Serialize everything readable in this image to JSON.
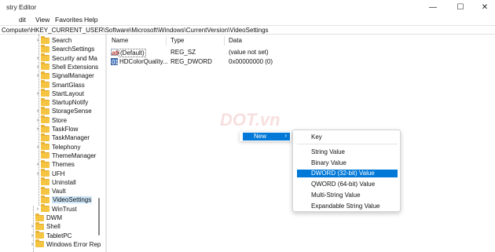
{
  "window": {
    "title": "stry Editor",
    "controls": {
      "minimize": "—",
      "maximize": "☐",
      "close": "✕"
    }
  },
  "menubar": {
    "items": [
      "dit",
      "View",
      "Favorites",
      "Help"
    ]
  },
  "address": "Computer\\HKEY_CURRENT_USER\\Software\\Microsoft\\Windows\\CurrentVersion\\VideoSettings",
  "tree": {
    "items": [
      {
        "label": "Search",
        "expander": "›"
      },
      {
        "label": "SearchSettings",
        "expander": ""
      },
      {
        "label": "Security and Ma",
        "expander": "›"
      },
      {
        "label": "Shell Extensions",
        "expander": "›"
      },
      {
        "label": "SignalManager",
        "expander": "›"
      },
      {
        "label": "SmartGlass",
        "expander": ""
      },
      {
        "label": "StartLayout",
        "expander": "›"
      },
      {
        "label": "StartupNotify",
        "expander": ""
      },
      {
        "label": "StorageSense",
        "expander": "›"
      },
      {
        "label": "Store",
        "expander": "›"
      },
      {
        "label": "TaskFlow",
        "expander": "›"
      },
      {
        "label": "TaskManager",
        "expander": ""
      },
      {
        "label": "Telephony",
        "expander": "›"
      },
      {
        "label": "ThemeManager",
        "expander": ""
      },
      {
        "label": "Themes",
        "expander": "›"
      },
      {
        "label": "UFH",
        "expander": "›"
      },
      {
        "label": "Uninstall",
        "expander": ""
      },
      {
        "label": "Vault",
        "expander": ""
      },
      {
        "label": "VideoSettings",
        "expander": "",
        "selected": true
      },
      {
        "label": "WinTrust",
        "expander": "›"
      },
      {
        "label": "DWM",
        "expander": ""
      },
      {
        "label": "Shell",
        "expander": "›"
      },
      {
        "label": "TabletPC",
        "expander": "›"
      },
      {
        "label": "Windows Error Rep",
        "expander": "›"
      }
    ]
  },
  "list": {
    "columns": [
      "Name",
      "Type",
      "Data"
    ],
    "rows": [
      {
        "name": "(Default)",
        "type": "REG_SZ",
        "data": "(value not set)",
        "icon": "ab"
      },
      {
        "name": "HDColorQuality...",
        "type": "REG_DWORD",
        "data": "0x00000000 (0)",
        "icon": "bin"
      }
    ]
  },
  "watermark": "DOT.vn",
  "context_menu": {
    "new_label": "New",
    "new_arrow": "›",
    "submenu": [
      {
        "label": "Key"
      },
      {
        "label": "String Value"
      },
      {
        "label": "Binary Value"
      },
      {
        "label": "DWORD (32-bit) Value",
        "highlight": true
      },
      {
        "label": "QWORD (64-bit) Value"
      },
      {
        "label": "Multi-String Value"
      },
      {
        "label": "Expandable String Value"
      }
    ]
  },
  "colors": {
    "accent": "#0078d7",
    "selection": "#cce4f7",
    "folder": "#f5c542"
  }
}
